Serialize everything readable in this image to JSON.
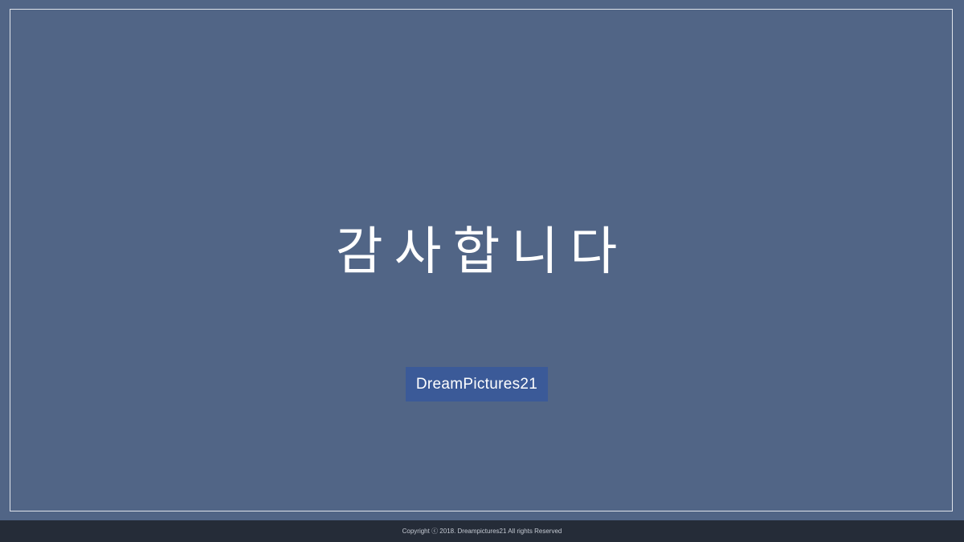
{
  "slide": {
    "title": "감사합니다",
    "logo_text": "DreamPictures21"
  },
  "footer": {
    "copyright": "Copyright ⓒ 2018. Dreampictures21 All rights Reserved"
  },
  "colors": {
    "background": "#516586",
    "frame": "#dfe3ea",
    "logo_bg": "#3b5a98",
    "footer_bg": "#252c38",
    "text": "#ffffff"
  }
}
